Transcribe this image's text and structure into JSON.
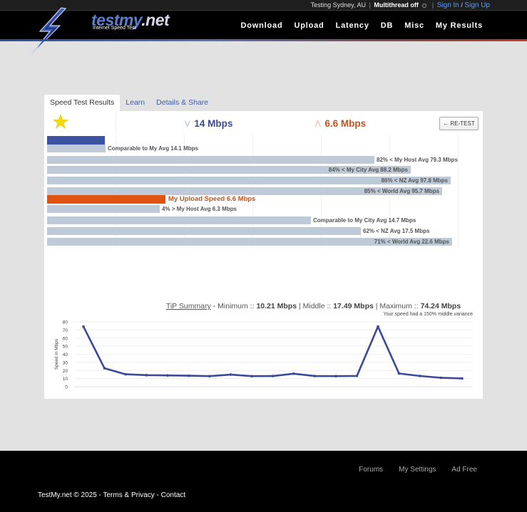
{
  "topbar": {
    "location": "Testing Sydney, AU",
    "multithread": "Multithread off",
    "signin": "Sign In",
    "slash": "/",
    "signup": "Sign Up"
  },
  "logo": {
    "name_a": "testmy",
    "name_b": ".net",
    "tagline": "Internet Speed Test"
  },
  "nav": [
    "Download",
    "Upload",
    "Latency",
    "DB",
    "Misc",
    "My Results"
  ],
  "tabs": [
    "Speed Test Results",
    "Learn",
    "Details & Share"
  ],
  "results": {
    "download": "14 Mbps",
    "upload": "6.6 Mbps",
    "retest": "← RE-TEST"
  },
  "download_bars": [
    {
      "label": "",
      "value": 14.0,
      "kind": "primary"
    },
    {
      "label": "Comparable to My Avg 14.1 Mbps",
      "value": 14.1,
      "kind": "compare",
      "pos": "out"
    },
    {
      "label": "82% < My Host Avg 79.3 Mbps",
      "value": 79.3,
      "kind": "compare",
      "pos": "out"
    },
    {
      "label": "84% < My City Avg 88.2 Mbps",
      "value": 88.2,
      "kind": "compare",
      "pos": "in"
    },
    {
      "label": "86% < NZ Avg 97.8 Mbps",
      "value": 97.8,
      "kind": "compare",
      "pos": "in"
    },
    {
      "label": "85% < World Avg 95.7 Mbps",
      "value": 95.7,
      "kind": "compare",
      "pos": "in"
    }
  ],
  "upload_bars": [
    {
      "label": "My Upload Speed 6.6 Mbps",
      "value": 6.6,
      "kind": "primary",
      "pos": "out"
    },
    {
      "label": "4% > My Host Avg 6.3 Mbps",
      "value": 6.3,
      "kind": "compare",
      "pos": "out"
    },
    {
      "label": "Comparable to My City Avg 14.7 Mbps",
      "value": 14.7,
      "kind": "compare",
      "pos": "out"
    },
    {
      "label": "62% < NZ Avg 17.5 Mbps",
      "value": 17.5,
      "kind": "compare",
      "pos": "out"
    },
    {
      "label": "71% < World Avg 22.6 Mbps",
      "value": 22.6,
      "kind": "compare",
      "pos": "in"
    }
  ],
  "tip": {
    "summary": "TiP Summary",
    "dash": " - ",
    "min_label": "Minimum :: ",
    "min": "10.21 Mbps",
    "mid_label": " | Middle :: ",
    "mid": "17.49 Mbps",
    "max_label": " | Maximum :: ",
    "max": "74.24 Mbps",
    "variance": "Your speed had a 150% middle variance"
  },
  "chart_data": {
    "type": "line",
    "ylabel": "Speed in Mbps",
    "ylim": [
      0,
      80
    ],
    "yticks": [
      0,
      10,
      20,
      30,
      40,
      50,
      60,
      70,
      80
    ],
    "grid": true,
    "series": [
      {
        "values": [
          74.2,
          22.8,
          15.3,
          14.2,
          13.9,
          13.5,
          13.0,
          14.9,
          13.0,
          13.1,
          16.0,
          13.1,
          13.0,
          13.3,
          74.2,
          16.3,
          13.2,
          11.0,
          10.2
        ],
        "color": "#3a4a96"
      }
    ]
  },
  "colors": {
    "download": "#3e52a3",
    "upload": "#de5410",
    "compare": "#bfcad9"
  },
  "footer": {
    "links": [
      "Forums",
      "My Settings",
      "Ad Free"
    ],
    "copyright": "TestMy.net © 2025",
    "sep1": " - ",
    "terms": "Terms & Privacy",
    "sep2": " - ",
    "contact": "Contact"
  }
}
